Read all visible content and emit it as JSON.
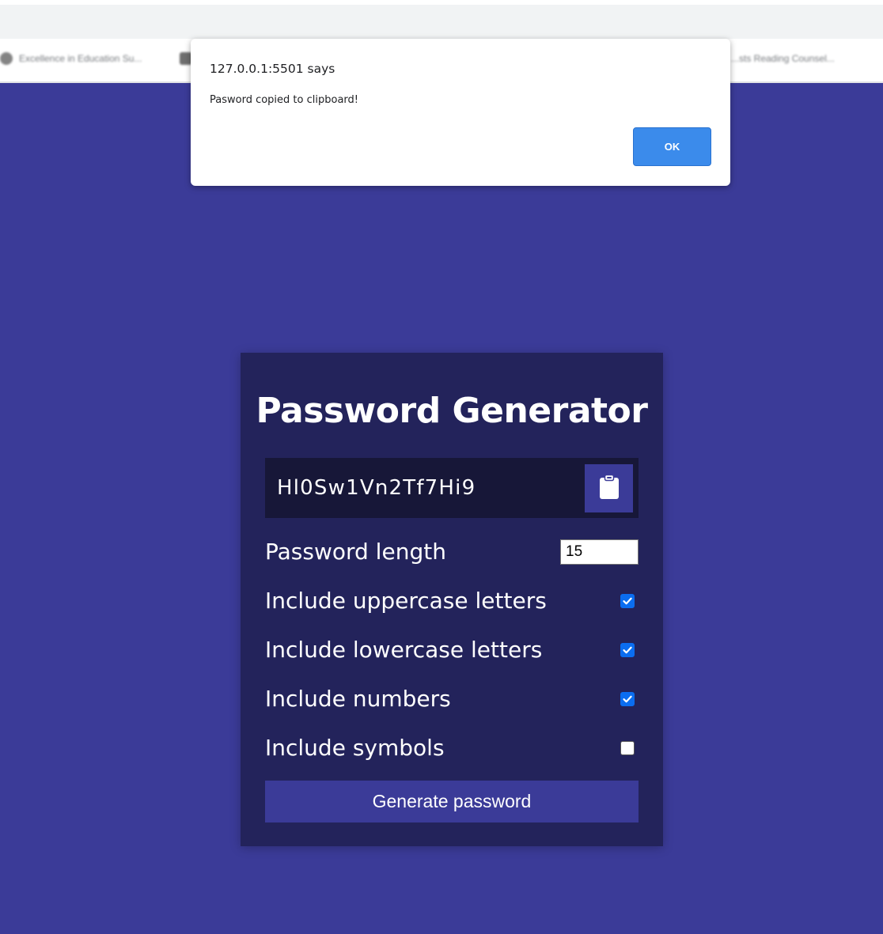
{
  "browser": {
    "bookmarks": [
      {
        "label": "Excellence in Education Su...",
        "icon": "globe-icon"
      },
      {
        "label": "",
        "icon": "page-icon"
      },
      {
        "label": "...sts Reading Counsel...",
        "icon": "none"
      }
    ]
  },
  "alert": {
    "origin": "127.0.0.1:5501 says",
    "message": "Pasword copied to clipboard!",
    "ok_label": "OK"
  },
  "generator": {
    "title": "Password Generator",
    "password": "Hl0Sw1Vn2Tf7Hi9",
    "clipboard_icon": "clipboard-icon",
    "length_label": "Password length",
    "length_value": "15",
    "options": [
      {
        "label": "Include uppercase letters",
        "checked": true
      },
      {
        "label": "Include lowercase letters",
        "checked": true
      },
      {
        "label": "Include numbers",
        "checked": true
      },
      {
        "label": "Include symbols",
        "checked": false
      }
    ],
    "generate_label": "Generate password"
  },
  "colors": {
    "page_background": "#3b3b98",
    "card_background": "#23235b",
    "result_background": "#171738",
    "accent": "#3b3b98",
    "alert_button": "#3b8beb",
    "checkbox_checked": "#0b6df0"
  }
}
